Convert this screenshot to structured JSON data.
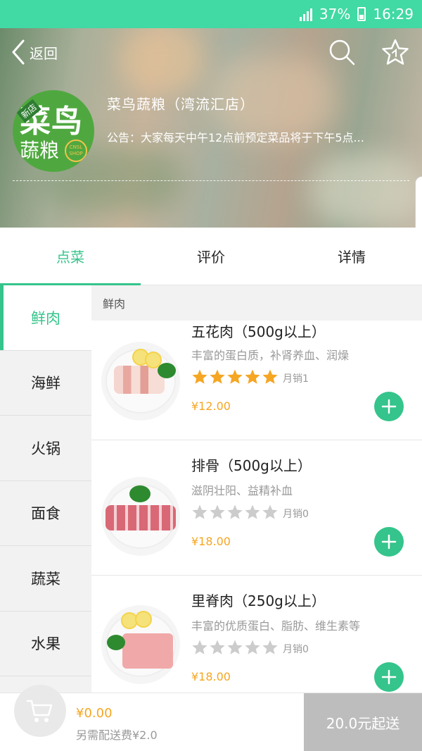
{
  "status_bar": {
    "battery": "37%",
    "time": "16:29"
  },
  "header": {
    "back_label": "返回",
    "shop_name": "菜鸟蔬粮（湾流汇店）",
    "notice": "公告：大家每天中午12点前预定菜品将于下午5点...",
    "logo": {
      "main": "菜鸟",
      "sub": "蔬粮",
      "tag": "新店",
      "seal": "CNSL SHOP"
    }
  },
  "tabs": [
    {
      "label": "点菜",
      "active": true
    },
    {
      "label": "评价",
      "active": false
    },
    {
      "label": "详情",
      "active": false
    }
  ],
  "sidebar": {
    "items": [
      {
        "label": "鲜肉",
        "active": true
      },
      {
        "label": "海鲜"
      },
      {
        "label": "火锅"
      },
      {
        "label": "面食"
      },
      {
        "label": "蔬菜"
      },
      {
        "label": "水果"
      }
    ]
  },
  "section_title": "鲜肉",
  "products": [
    {
      "name": "五花肉（500g以上）",
      "desc": "丰富的蛋白质，补肾养血、润燥",
      "rating": 5,
      "sales": "月销1",
      "price": "¥12.00",
      "image": "pork-belly"
    },
    {
      "name": "排骨（500g以上）",
      "desc": "滋阴壮阳、益精补血",
      "rating": 0,
      "sales": "月销0",
      "price": "¥18.00",
      "image": "pork-ribs"
    },
    {
      "name": "里脊肉（250g以上）",
      "desc": "丰富的优质蛋白、脂肪、维生素等",
      "rating": 0,
      "sales": "月销0",
      "price": "¥18.00",
      "image": "pork-tenderloin"
    }
  ],
  "cart": {
    "total": "¥0.00",
    "delivery_fee": "另需配送费¥2.0",
    "min_order": "20.0元起送"
  },
  "colors": {
    "accent": "#35c48b",
    "status_bar": "#41d9a4",
    "price": "#f5a623",
    "star_filled": "#f5a623",
    "star_empty": "#cccccc"
  }
}
